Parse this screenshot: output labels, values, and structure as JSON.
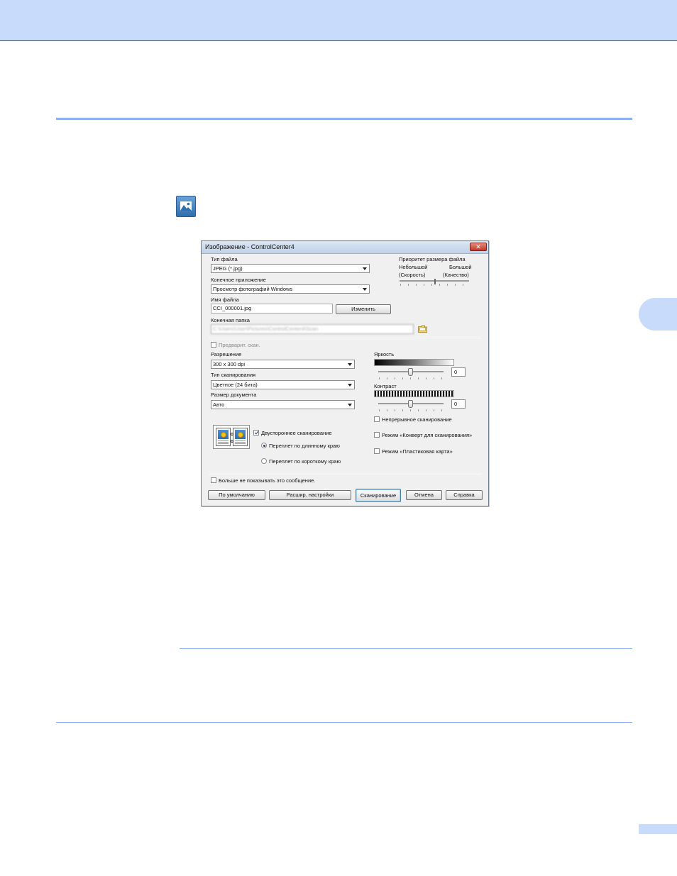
{
  "dialog": {
    "title": "Изображение - ControlCenter4",
    "close_glyph": "✕",
    "file_type": {
      "label": "Тип файла",
      "value": "JPEG (*.jpg)"
    },
    "target_app": {
      "label": "Конечное приложение",
      "value": "Просмотр фотографий Windows"
    },
    "file_name": {
      "label": "Имя файла",
      "value": "CCI_000001.jpg",
      "change_button": "Изменить"
    },
    "dest_folder": {
      "label": "Конечная папка",
      "value": "C:\\Users\\User\\Pictures\\ControlCenter4\\Scan"
    },
    "size_priority": {
      "label": "Приоритет размера файла",
      "small": "Небольшой",
      "small_note": "(Скорость)",
      "large": "Большой",
      "large_note": "(Качество)"
    },
    "prescan": {
      "label": "Предварит. скан.",
      "checked": false
    },
    "resolution": {
      "label": "Разрешение",
      "value": "300 x 300 dpi"
    },
    "scan_type": {
      "label": "Тип сканирования",
      "value": "Цветное (24 бита)"
    },
    "doc_size": {
      "label": "Размер документа",
      "value": "Авто"
    },
    "brightness": {
      "label": "Яркость",
      "value": "0"
    },
    "contrast": {
      "label": "Контраст",
      "value": "0"
    },
    "continuous": {
      "label": "Непрерывное сканирование",
      "checked": false
    },
    "duplex": {
      "label": "Двустороннее сканирование",
      "checked": true,
      "long_edge": "Переплет по длинному краю",
      "short_edge": "Переплет по короткому краю",
      "selected": "long_edge"
    },
    "envelope_mode": {
      "label": "Режим «Конверт для сканирования»",
      "checked": false
    },
    "plastic_card_mode": {
      "label": "Режим «Пластиковая карта»",
      "checked": false
    },
    "dont_show": {
      "label": "Больше не показывать это сообщение.",
      "checked": false
    },
    "buttons": {
      "default": "По умолчанию",
      "advanced": "Расшир. настройки",
      "scan": "Сканирование",
      "cancel": "Отмена",
      "help": "Справка"
    }
  },
  "colors": {
    "accent_band": "#c9dbfb",
    "rule": "#8fb0ee"
  },
  "icons": {
    "app_icon": "image-icon",
    "folder": "folder-icon"
  }
}
